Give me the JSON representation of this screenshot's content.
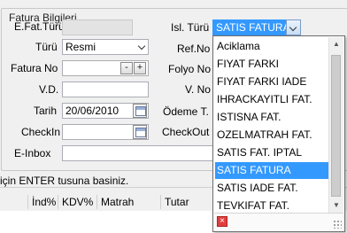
{
  "group": {
    "title": "Fatura Bilgileri"
  },
  "left": {
    "efat_label": "E.Fat.Türü",
    "type_label": "Türü",
    "type_value": "Resmi",
    "fatura_no_label": "Fatura No",
    "minus": "-",
    "plus": "+",
    "vd_label": "V.D.",
    "date_label": "Tarih",
    "date_value": "20/06/2010",
    "checkin_label": "CheckIn",
    "einbox_label": "E-Inbox"
  },
  "right": {
    "isl_label": "Isl. Türü",
    "isl_value": "SATIS FATURA",
    "ref_label": "Ref.No",
    "folyo_label": "Folyo No",
    "vno_label": "V. No",
    "odeme_label": "Ödeme T.",
    "checkout_label": "CheckOut"
  },
  "hint": "için ENTER tusuna basiniz.",
  "grid": {
    "columns": [
      "İnd%",
      "KDV%",
      "Matrah",
      "Tutar"
    ]
  },
  "dropdown": {
    "items": [
      "Aciklama",
      "FIYAT FARKI",
      "FIYAT FARKI IADE",
      "IHRACKAYITLI FAT.",
      "ISTISNA FAT.",
      "OZELMATRAH FAT.",
      "SATIS FAT. IPTAL",
      "SATIS FATURA",
      "SATIS IADE FAT.",
      "TEVKIFAT FAT."
    ],
    "selected": "SATIS FATURA",
    "close_glyph": "×"
  },
  "colors": {
    "selection": "#3399ff",
    "accent_field": "#3399ff"
  }
}
